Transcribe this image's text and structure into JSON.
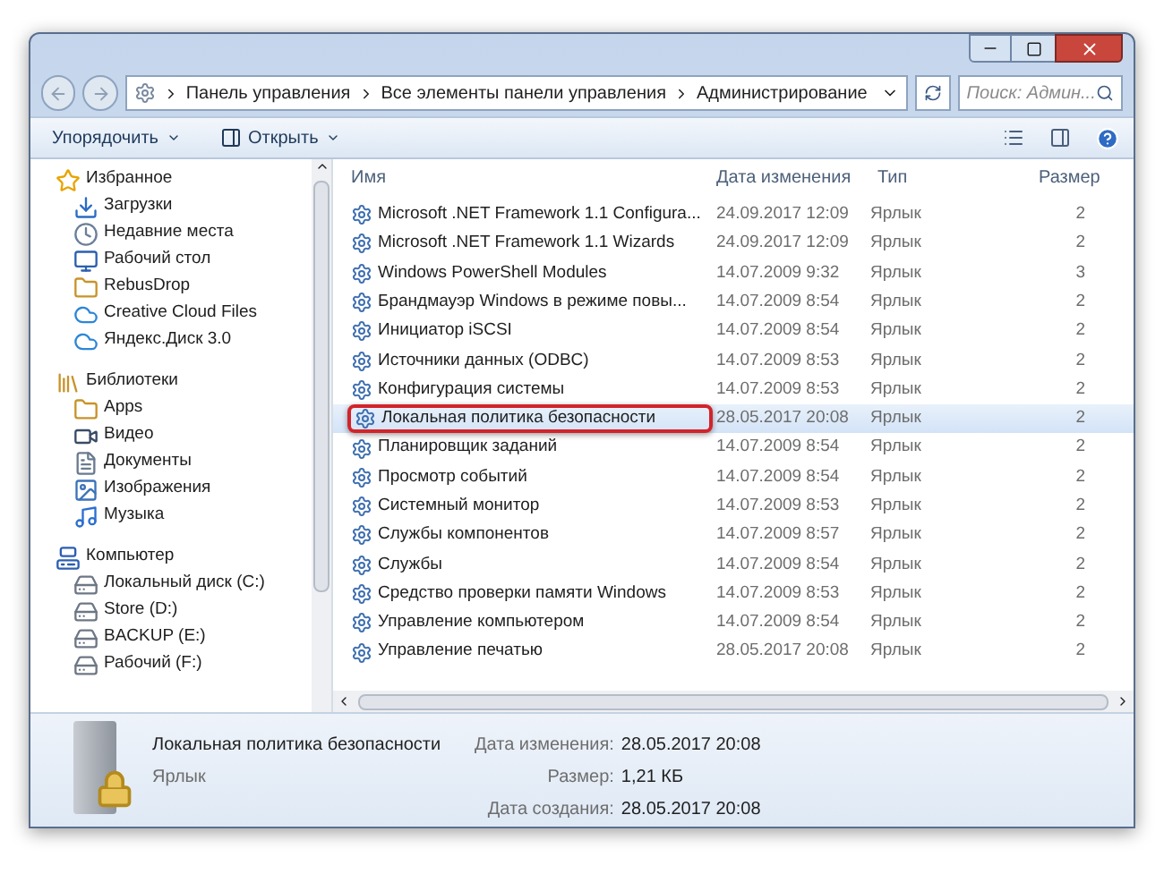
{
  "address": {
    "crumbs": [
      "Панель управления",
      "Все элементы панели управления",
      "Администрирование"
    ]
  },
  "search": {
    "placeholder": "Поиск: Админ..."
  },
  "toolbar": {
    "buttons": [
      "Упорядочить",
      "Открыть"
    ]
  },
  "sidebar": {
    "groups": [
      {
        "label": "Избранное",
        "kind": "favorites",
        "children": [
          {
            "label": "Загрузки",
            "kind": "download"
          },
          {
            "label": "Недавние места",
            "kind": "recent"
          },
          {
            "label": "Рабочий стол",
            "kind": "desktop"
          },
          {
            "label": "RebusDrop",
            "kind": "folder"
          },
          {
            "label": "Creative Cloud Files",
            "kind": "cloud"
          },
          {
            "label": "Яндекс.Диск 3.0",
            "kind": "cloud"
          }
        ]
      },
      {
        "label": "Библиотеки",
        "kind": "library",
        "children": [
          {
            "label": "Apps",
            "kind": "folder"
          },
          {
            "label": "Видео",
            "kind": "video"
          },
          {
            "label": "Документы",
            "kind": "document"
          },
          {
            "label": "Изображения",
            "kind": "image"
          },
          {
            "label": "Музыка",
            "kind": "music"
          }
        ]
      },
      {
        "label": "Компьютер",
        "kind": "computer",
        "children": [
          {
            "label": "Локальный диск (C:)",
            "kind": "drive"
          },
          {
            "label": "Store (D:)",
            "kind": "drive"
          },
          {
            "label": "BACKUP (E:)",
            "kind": "drive"
          },
          {
            "label": "Рабочий (F:)",
            "kind": "drive"
          }
        ]
      }
    ]
  },
  "table": {
    "columns": [
      "Имя",
      "Дата изменения",
      "Тип",
      "Размер"
    ],
    "rows": [
      {
        "name": "Microsoft .NET Framework 1.1 Configura...",
        "date": "24.09.2017 12:09",
        "type": "Ярлык",
        "size": "2",
        "selected": false,
        "highlighted": false
      },
      {
        "name": "Microsoft .NET Framework 1.1 Wizards",
        "date": "24.09.2017 12:09",
        "type": "Ярлык",
        "size": "2",
        "selected": false,
        "highlighted": false
      },
      {
        "name": "Windows PowerShell Modules",
        "date": "14.07.2009 9:32",
        "type": "Ярлык",
        "size": "3",
        "selected": false,
        "highlighted": false
      },
      {
        "name": "Брандмауэр Windows в режиме повы...",
        "date": "14.07.2009 8:54",
        "type": "Ярлык",
        "size": "2",
        "selected": false,
        "highlighted": false
      },
      {
        "name": "Инициатор iSCSI",
        "date": "14.07.2009 8:54",
        "type": "Ярлык",
        "size": "2",
        "selected": false,
        "highlighted": false
      },
      {
        "name": "Источники данных (ODBC)",
        "date": "14.07.2009 8:53",
        "type": "Ярлык",
        "size": "2",
        "selected": false,
        "highlighted": false
      },
      {
        "name": "Конфигурация системы",
        "date": "14.07.2009 8:53",
        "type": "Ярлык",
        "size": "2",
        "selected": false,
        "highlighted": false
      },
      {
        "name": "Локальная политика безопасности",
        "date": "28.05.2017 20:08",
        "type": "Ярлык",
        "size": "2",
        "selected": true,
        "highlighted": true
      },
      {
        "name": "Планировщик заданий",
        "date": "14.07.2009 8:54",
        "type": "Ярлык",
        "size": "2",
        "selected": false,
        "highlighted": false
      },
      {
        "name": "Просмотр событий",
        "date": "14.07.2009 8:54",
        "type": "Ярлык",
        "size": "2",
        "selected": false,
        "highlighted": false
      },
      {
        "name": "Системный монитор",
        "date": "14.07.2009 8:53",
        "type": "Ярлык",
        "size": "2",
        "selected": false,
        "highlighted": false
      },
      {
        "name": "Службы компонентов",
        "date": "14.07.2009 8:57",
        "type": "Ярлык",
        "size": "2",
        "selected": false,
        "highlighted": false
      },
      {
        "name": "Службы",
        "date": "14.07.2009 8:54",
        "type": "Ярлык",
        "size": "2",
        "selected": false,
        "highlighted": false
      },
      {
        "name": "Средство проверки памяти Windows",
        "date": "14.07.2009 8:53",
        "type": "Ярлык",
        "size": "2",
        "selected": false,
        "highlighted": false
      },
      {
        "name": "Управление компьютером",
        "date": "14.07.2009 8:54",
        "type": "Ярлык",
        "size": "2",
        "selected": false,
        "highlighted": false
      },
      {
        "name": "Управление печатью",
        "date": "28.05.2017 20:08",
        "type": "Ярлык",
        "size": "2",
        "selected": false,
        "highlighted": false
      }
    ]
  },
  "details": {
    "name": "Локальная политика безопасности",
    "type": "Ярлык",
    "fields": [
      {
        "label": "Дата изменения:",
        "value": "28.05.2017 20:08"
      },
      {
        "label": "Размер:",
        "value": "1,21 КБ"
      },
      {
        "label": "Дата создания:",
        "value": "28.05.2017 20:08"
      }
    ]
  }
}
